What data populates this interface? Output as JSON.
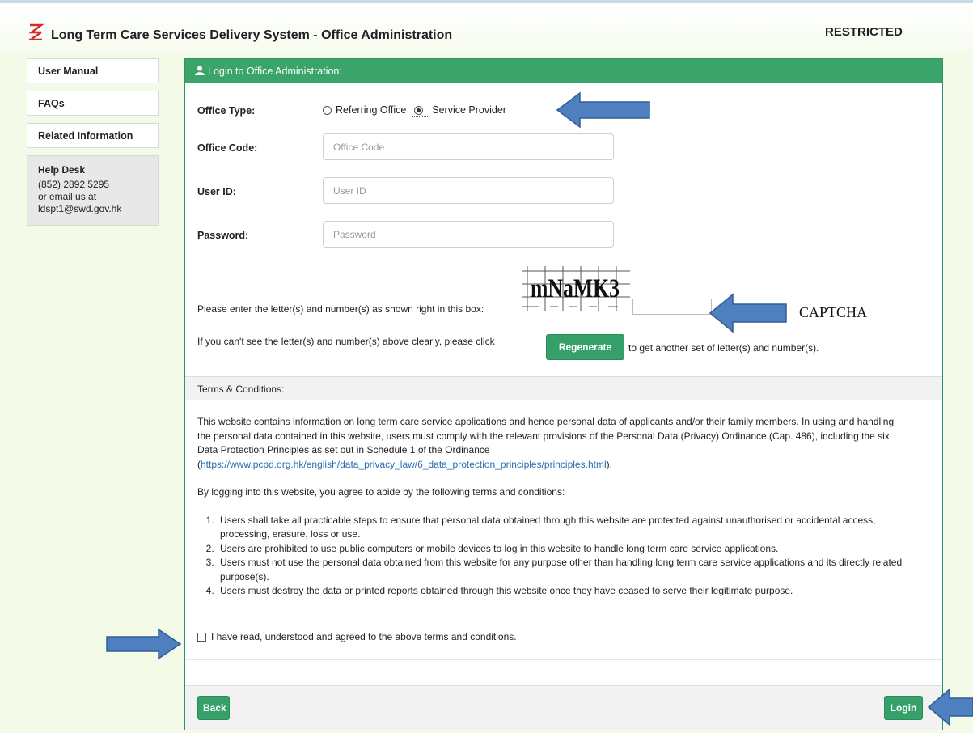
{
  "header": {
    "title": "Long Term Care Services Delivery System - Office Administration",
    "classification": "RESTRICTED"
  },
  "sidebar": {
    "items": [
      {
        "label": "User Manual"
      },
      {
        "label": "FAQs"
      },
      {
        "label": "Related Information"
      }
    ],
    "help": {
      "heading": "Help Desk",
      "phone": "(852) 2892 5295",
      "email_prefix": "or email us at",
      "email": "ldspt1@swd.gov.hk"
    }
  },
  "login": {
    "panel_title": "Login to Office Administration:",
    "office_type_label": "Office Type:",
    "office_type_options": [
      "Referring Office",
      "Service Provider"
    ],
    "office_type_selected": "Service Provider",
    "office_code_label": "Office Code:",
    "office_code_placeholder": "Office Code",
    "office_code_value": "",
    "user_id_label": "User ID:",
    "user_id_placeholder": "User ID",
    "user_id_value": "",
    "password_label": "Password:",
    "password_placeholder": "Password",
    "password_value": "",
    "captcha_prompt": "Please enter the letter(s) and number(s) as shown right in this box:",
    "captcha_image_text": "mNaMK3",
    "captcha_value": "",
    "regen_before": "If you can't see the letter(s) and number(s) above clearly, please click",
    "regen_button": "Regenerate",
    "regen_after": "to get another set of letter(s) and number(s)."
  },
  "terms": {
    "heading": "Terms & Conditions:",
    "para1": "This website contains information on long term care service applications and hence personal data of applicants and/or their family members. In using and handling the personal data contained in this website, users must comply with the relevant provisions of the Personal Data (Privacy) Ordinance (Cap. 486), including the six Data Protection Principles as set out in Schedule 1 of the Ordinance",
    "link_open": "(",
    "link": "https://www.pcpd.org.hk/english/data_privacy_law/6_data_protection_principles/principles.html",
    "link_close": ").",
    "para2": "By logging into this website, you agree to abide by the following terms and conditions:",
    "list": [
      "Users shall take all practicable steps to ensure that personal data obtained through this website are protected against unauthorised or accidental access, processing, erasure, loss or use.",
      "Users are prohibited to use public computers or mobile devices to log in this website to handle long term care service applications.",
      "Users must not use the personal data obtained from this website for any purpose other than handling long term care service applications and its directly related purpose(s).",
      "Users must destroy the data or printed reports obtained through this website once they have ceased to serve their legitimate purpose."
    ],
    "agree_label": "I have read, understood and agreed to the above terms and conditions.",
    "agree_checked": false
  },
  "buttons": {
    "back": "Back",
    "login": "Login"
  },
  "annotations": {
    "captcha_label": "CAPTCHA",
    "arrow_color": "#4f7fc0"
  },
  "colors": {
    "accent_green": "#3aa46a",
    "page_background": "#f3fbe8",
    "logo_red": "#d22b2b"
  }
}
